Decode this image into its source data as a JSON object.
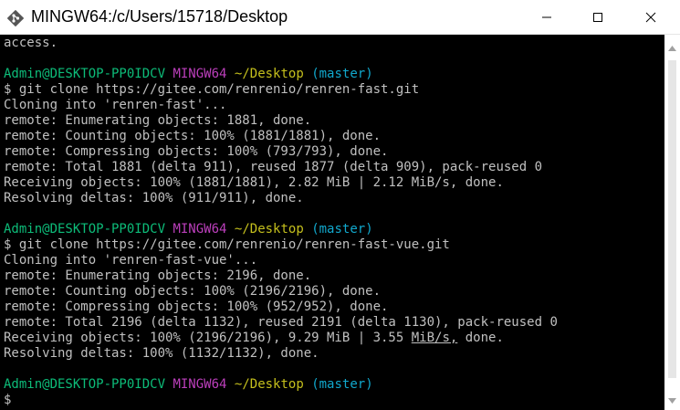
{
  "window": {
    "title": "MINGW64:/c/Users/15718/Desktop",
    "app_icon": "git-bash-icon",
    "controls": [
      "minimize-icon",
      "maximize-icon",
      "close-icon"
    ]
  },
  "colors": {
    "user": "#0dbc79",
    "system": "#bc3fbc",
    "path": "#c5c01d",
    "branch": "#11a8cd",
    "text": "#c0c0c0"
  },
  "terminal": {
    "lines": [
      {
        "text": "access."
      },
      {
        "text": ""
      },
      {
        "prompt": {
          "user": "Admin@DESKTOP-PP0IDCV",
          "system": "MINGW64",
          "path": "~/Desktop",
          "branch": "(master)"
        }
      },
      {
        "text": "$ git clone https://gitee.com/renrenio/renren-fast.git"
      },
      {
        "text": "Cloning into 'renren-fast'..."
      },
      {
        "text": "remote: Enumerating objects: 1881, done."
      },
      {
        "text": "remote: Counting objects: 100% (1881/1881), done."
      },
      {
        "text": "remote: Compressing objects: 100% (793/793), done."
      },
      {
        "text": "remote: Total 1881 (delta 911), reused 1877 (delta 909), pack-reused 0"
      },
      {
        "text": "Receiving objects: 100% (1881/1881), 2.82 MiB | 2.12 MiB/s, done."
      },
      {
        "text": "Resolving deltas: 100% (911/911), done."
      },
      {
        "text": ""
      },
      {
        "prompt": {
          "user": "Admin@DESKTOP-PP0IDCV",
          "system": "MINGW64",
          "path": "~/Desktop",
          "branch": "(master)"
        }
      },
      {
        "text": "$ git clone https://gitee.com/renrenio/renren-fast-vue.git"
      },
      {
        "text": "Cloning into 'renren-fast-vue'..."
      },
      {
        "text": "remote: Enumerating objects: 2196, done."
      },
      {
        "text": "remote: Counting objects: 100% (2196/2196), done."
      },
      {
        "text": "remote: Compressing objects: 100% (952/952), done."
      },
      {
        "text": "remote: Total 2196 (delta 1132), reused 2191 (delta 1130), pack-reused 0"
      },
      {
        "segments": [
          {
            "text": "Receiving objects: 100% (2196/2196), 9.29 MiB | 3.55 "
          },
          {
            "text": "MiB/s,",
            "underline": true
          },
          {
            "text": " done."
          }
        ]
      },
      {
        "text": "Resolving deltas: 100% (1132/1132), done."
      },
      {
        "text": ""
      },
      {
        "prompt": {
          "user": "Admin@DESKTOP-PP0IDCV",
          "system": "MINGW64",
          "path": "~/Desktop",
          "branch": "(master)"
        }
      },
      {
        "text": "$ "
      }
    ]
  }
}
